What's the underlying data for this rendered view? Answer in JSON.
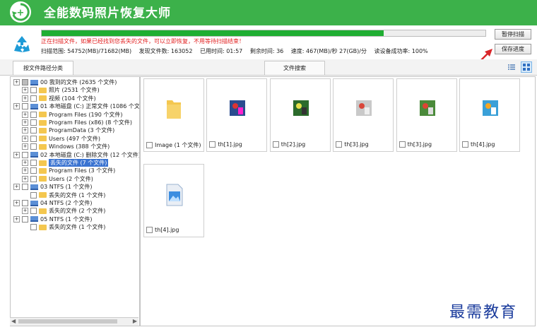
{
  "app": {
    "title": "全能数码照片恢复大师"
  },
  "scan": {
    "progress_fraction": 0.77,
    "message": "正在扫描文件，如果已经找到您丢失的文件，可以立即恢复，不用等待扫描结束！",
    "stats": {
      "range": "扫描范围: 54752(MB)/71682(MB)",
      "found": "发现文件数: 163052",
      "elapsed": "已用时间: 01:57",
      "remaining": "剩余时间: 36",
      "speed": "速度: 467(MB)/秒  27(GB)/分",
      "read_success": "读设备成功率: 100%"
    },
    "pause_label": "暂停扫描",
    "save_label": "保存进度"
  },
  "tabs": [
    {
      "label": "按文件路径分类"
    },
    {
      "label": "文件搜索"
    }
  ],
  "tree": [
    {
      "label": "00 我到的文件 (2635 个文件)",
      "icon": "drive-icon"
    },
    {
      "label": "照片  (2531 个文件)",
      "icon": "folder-icon"
    },
    {
      "label": "视频  (104 个文件)",
      "icon": "folder-icon"
    },
    {
      "label": "01 本地磁盘 (C:) 正常文件 (1086 个文",
      "icon": "drive-icon"
    },
    {
      "label": "Program Files  (190 个文件)",
      "icon": "folder-icon"
    },
    {
      "label": "Program Files (x86)  (8 个文件)",
      "icon": "folder-icon"
    },
    {
      "label": "ProgramData  (3 个文件)",
      "icon": "folder-icon"
    },
    {
      "label": "Users  (497 个文件)",
      "icon": "folder-icon"
    },
    {
      "label": "Windows  (388 个文件)",
      "icon": "folder-icon"
    },
    {
      "label": "02 本地磁盘 (C:) 删除文件 (12 个文件)",
      "icon": "drive-icon"
    },
    {
      "label": "丢失的文件  (7 个文件)",
      "icon": "folder-icon"
    },
    {
      "label": "Program Files  (3 个文件)",
      "icon": "folder-icon"
    },
    {
      "label": "Users  (2 个文件)",
      "icon": "folder-icon"
    },
    {
      "label": "03  NTFS  (1 个文件)",
      "icon": "drive-icon"
    },
    {
      "label": "丢失的文件  (1 个文件)",
      "icon": "folder-icon"
    },
    {
      "label": "04  NTFS  (2 个文件)",
      "icon": "drive-icon"
    },
    {
      "label": "丢失的文件  (2 个文件)",
      "icon": "folder-icon"
    },
    {
      "label": "05  NTFS  (1 个文件)",
      "icon": "drive-icon"
    },
    {
      "label": "丢失的文件  (1 个文件)",
      "icon": "folder-icon"
    }
  ],
  "files": [
    {
      "name": "Image  (1 个文件)",
      "kind": "folder-icon"
    },
    {
      "name": "th[1].jpg",
      "kind": "photo-thumbnail"
    },
    {
      "name": "th[2].jpg",
      "kind": "photo-thumbnail"
    },
    {
      "name": "th[3].jpg",
      "kind": "photo-thumbnail"
    },
    {
      "name": "th[3].jpg",
      "kind": "photo-thumbnail"
    },
    {
      "name": "th[4].jpg",
      "kind": "photo-thumbnail"
    },
    {
      "name": "th[4].jpg",
      "kind": "image-placeholder-icon"
    }
  ],
  "watermark": "最需教育",
  "colors": {
    "accent": "#3cb14a",
    "progress": "#1fae32",
    "message": "#e21f1f",
    "selection": "#3a73d1",
    "arrow": "#d9262a"
  }
}
